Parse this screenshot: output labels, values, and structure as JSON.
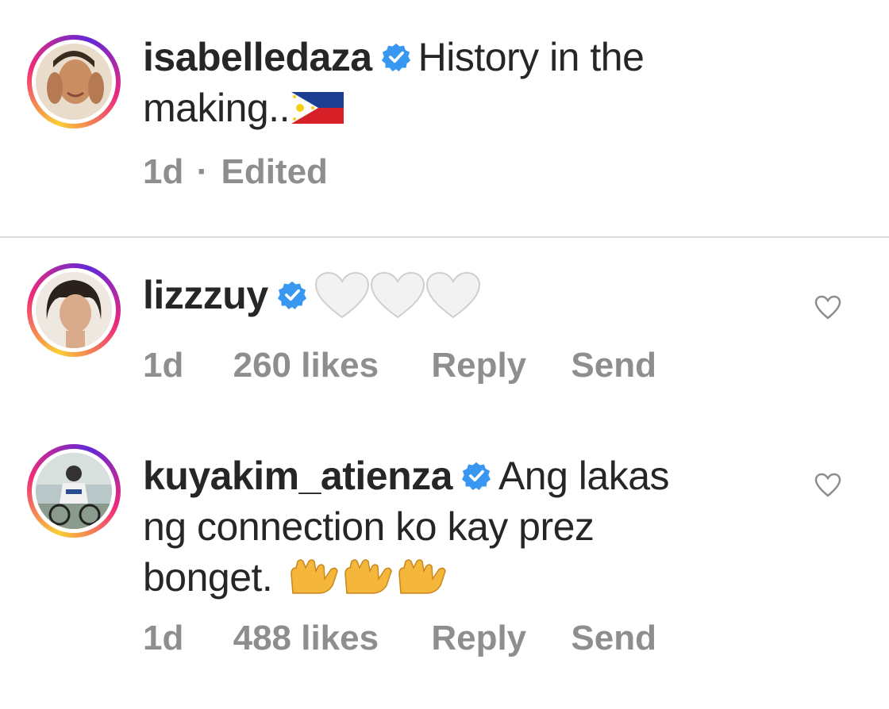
{
  "caption": {
    "username": "isabelledaza",
    "text_line1": "History in the",
    "text_line2": "making..",
    "emoji": "philippines-flag",
    "time": "1d",
    "separator": "·",
    "edited": "Edited"
  },
  "comments": [
    {
      "username": "lizzzuy",
      "emoji": "white-heart x3",
      "time": "1d",
      "likes": "260 likes",
      "reply": "Reply",
      "send": "Send"
    },
    {
      "username": "kuyakim_atienza",
      "text_line1": "Ang lakas",
      "text_line2": "ng connection ko kay prez",
      "text_line3": "bonget.",
      "emoji": "raising-hands x3",
      "time": "1d",
      "likes": "488 likes",
      "reply": "Reply",
      "send": "Send"
    }
  ],
  "colors": {
    "verified": "#3897f0",
    "meta": "#8e8e8e",
    "text": "#262626"
  }
}
